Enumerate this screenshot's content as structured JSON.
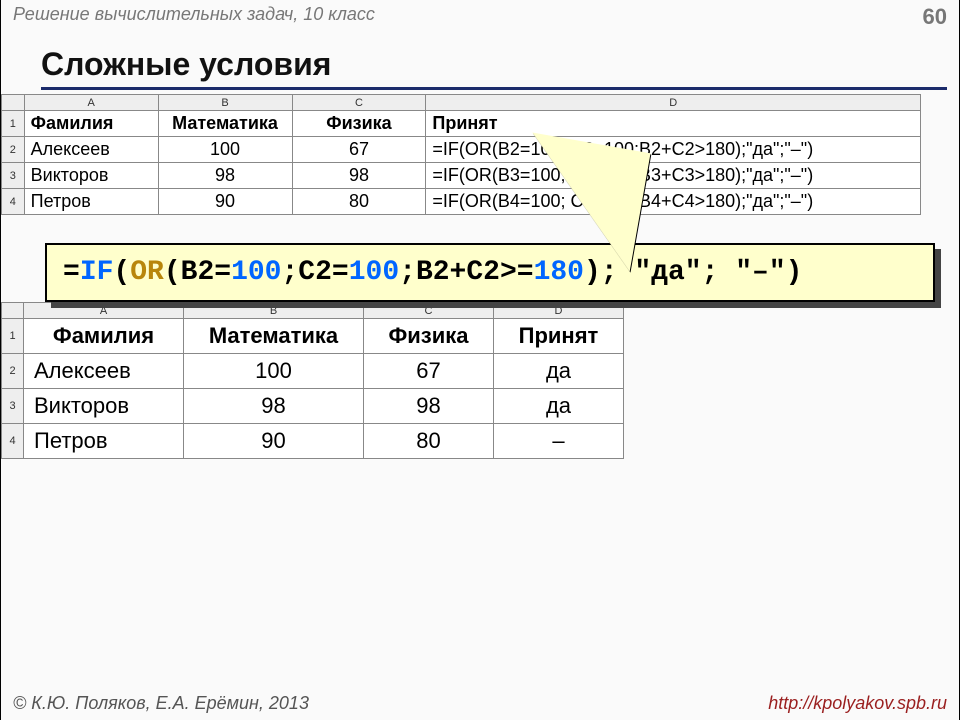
{
  "header": {
    "subject": "Решение вычислительных задач, 10 класс",
    "page": "60"
  },
  "title": "Сложные условия",
  "table1": {
    "cols": [
      "A",
      "B",
      "C",
      "D"
    ],
    "rows": [
      "1",
      "2",
      "3",
      "4"
    ],
    "headers": [
      "Фамилия",
      "Математика",
      "Физика",
      "Принят"
    ],
    "data": [
      [
        "Алексеев",
        "100",
        "67",
        "=IF(OR(B2=100; C2=100;B2+C2>180);\"да\";\"–\")"
      ],
      [
        "Викторов",
        "98",
        "98",
        "=IF(OR(B3=100; C3=100;B3+C3>180);\"да\";\"–\")"
      ],
      [
        "Петров",
        "90",
        "80",
        "=IF(OR(B4=100; C4=100;B4+C4>180);\"да\";\"–\")"
      ]
    ]
  },
  "formula": {
    "eq": "=",
    "if": "IF",
    "open1": "(",
    "or": "OR",
    "open2": "(",
    "b2eq": "B2=",
    "n100a": "100",
    "sc1": ";C2=",
    "n100b": "100",
    "sc2": ";B2+C2>=",
    "n180": "180",
    "close": "); \"да\"; \"–\")"
  },
  "table2": {
    "cols": [
      "A",
      "B",
      "C",
      "D"
    ],
    "rows": [
      "1",
      "2",
      "3",
      "4"
    ],
    "headers": [
      "Фамилия",
      "Математика",
      "Физика",
      "Принят"
    ],
    "data": [
      [
        "Алексеев",
        "100",
        "67",
        "да"
      ],
      [
        "Викторов",
        "98",
        "98",
        "да"
      ],
      [
        "Петров",
        "90",
        "80",
        "–"
      ]
    ]
  },
  "footer": {
    "copyright": "© К.Ю. Поляков, Е.А. Ерёмин, 2013",
    "url": "http://kpolyakov.spb.ru"
  }
}
